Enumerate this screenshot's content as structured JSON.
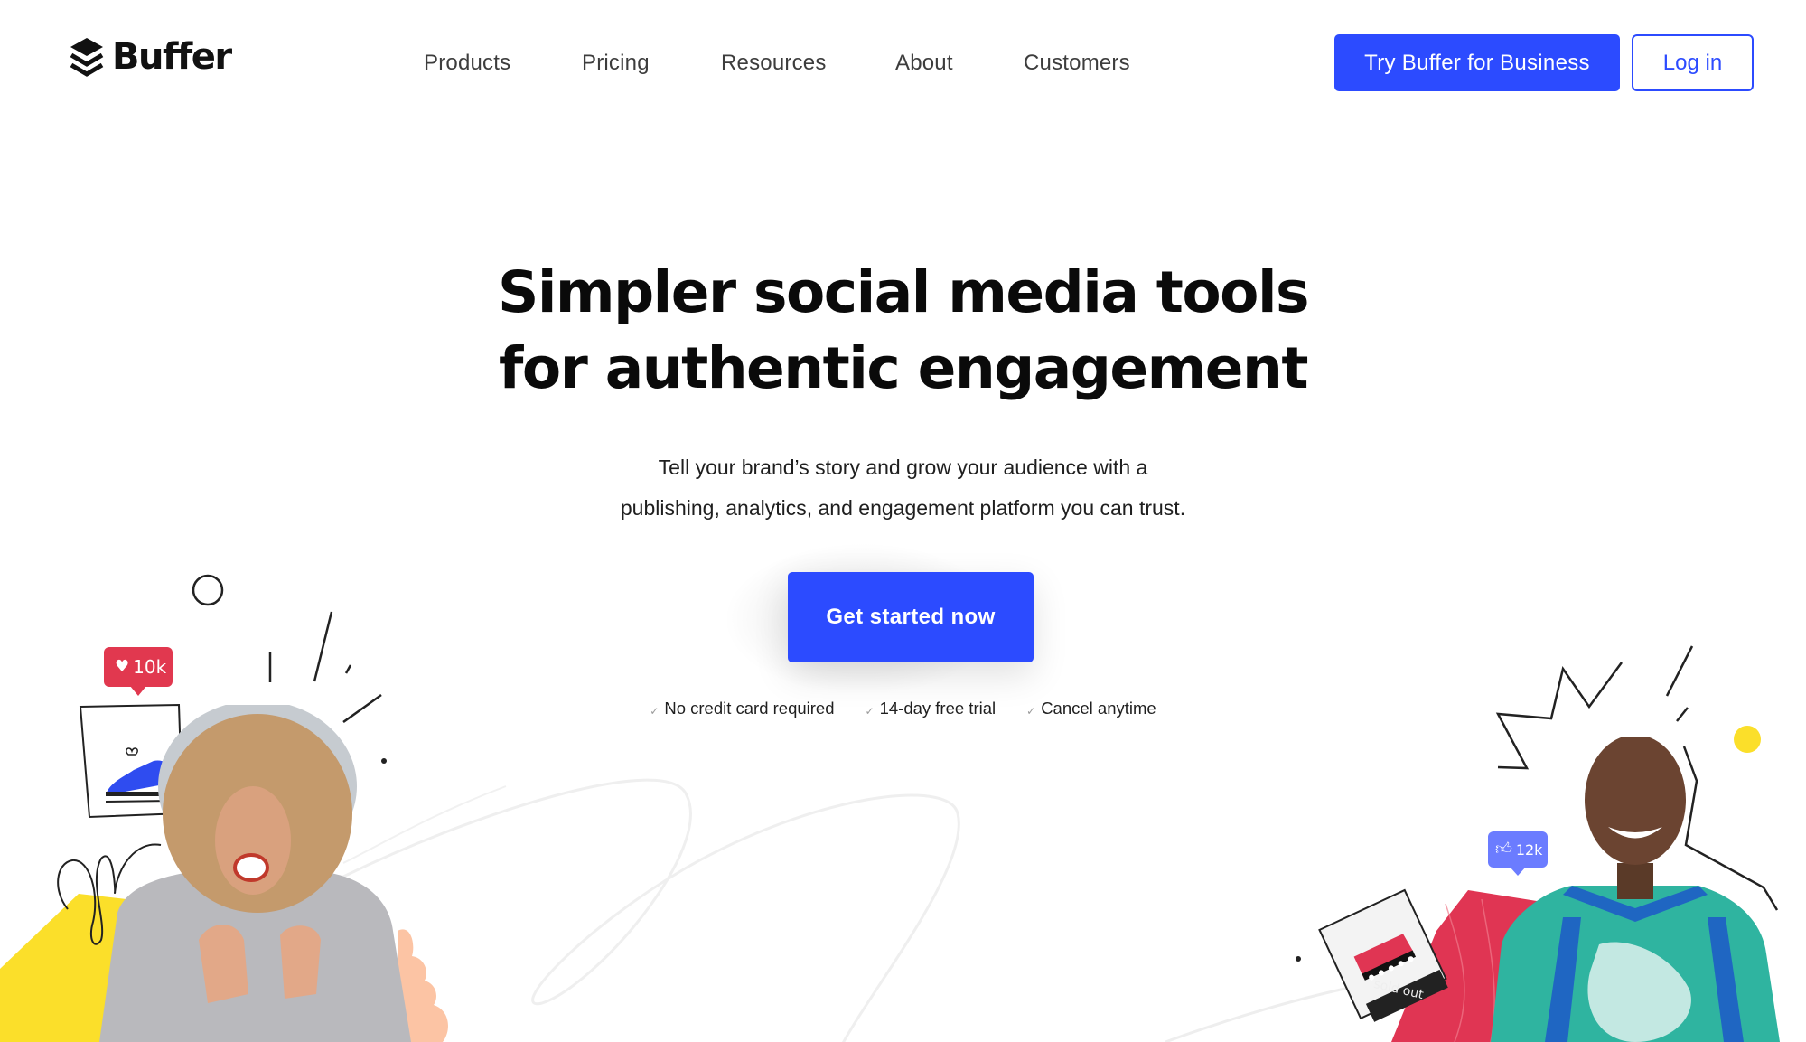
{
  "header": {
    "logo_text": "Buffer",
    "nav": [
      {
        "label": "Products"
      },
      {
        "label": "Pricing"
      },
      {
        "label": "Resources"
      },
      {
        "label": "About"
      },
      {
        "label": "Customers"
      }
    ],
    "business_button": "Try Buffer for Business",
    "login_button": "Log in"
  },
  "hero": {
    "title_lines": [
      "Simpler social media tools",
      "for authentic engagement"
    ],
    "subtitle_lines": [
      "Tell your brand’s story and grow your audience with a",
      "publishing, analytics, and engagement platform you can trust."
    ],
    "cta_label": "Get started now",
    "checks": [
      {
        "icon": "check-icon",
        "label": "No credit card required"
      },
      {
        "icon": "check-icon",
        "label": "14-day free trial"
      },
      {
        "icon": "check-icon",
        "label": "Cancel anytime"
      }
    ]
  },
  "illustrations": {
    "like_badge": {
      "icon": "heart-icon",
      "count": "10k"
    },
    "thumb_badge": {
      "icon": "thumbs-up-icon",
      "count": "12k"
    },
    "sold_out_tag": "sold out"
  },
  "colors": {
    "brand_blue": "#2c4bff",
    "like_red": "#e1384f",
    "thumb_blue": "#6b7cff",
    "accent_yellow": "#fbdf2a",
    "accent_peach": "#fcc4a4",
    "accent_red": "#e03553"
  }
}
